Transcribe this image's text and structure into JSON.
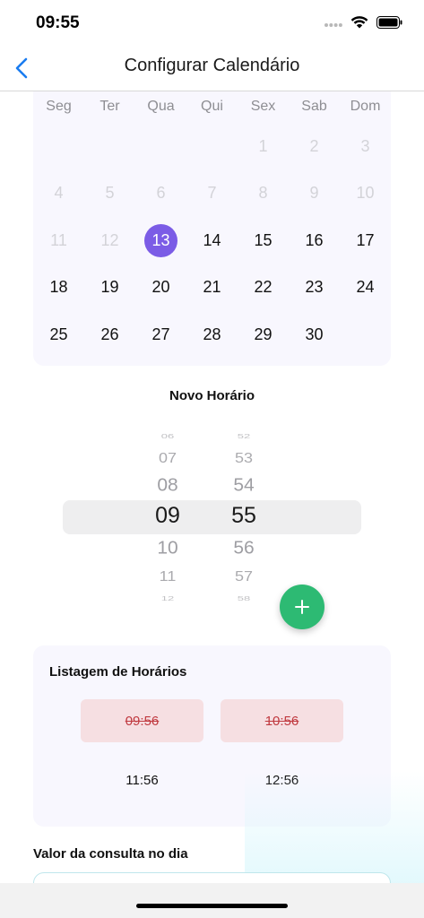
{
  "status_bar": {
    "time": "09:55"
  },
  "nav": {
    "title": "Configurar Calendário"
  },
  "calendar": {
    "weekdays": [
      "Seg",
      "Ter",
      "Qua",
      "Qui",
      "Sex",
      "Sab",
      "Dom"
    ],
    "rows": [
      [
        "",
        "",
        "",
        "",
        "1",
        "2",
        "3"
      ],
      [
        "4",
        "5",
        "6",
        "7",
        "8",
        "9",
        "10"
      ],
      [
        "11",
        "12",
        "13",
        "14",
        "15",
        "16",
        "17"
      ],
      [
        "18",
        "19",
        "20",
        "21",
        "22",
        "23",
        "24"
      ],
      [
        "25",
        "26",
        "27",
        "28",
        "29",
        "30",
        ""
      ]
    ],
    "muted_days": [
      "1",
      "2",
      "3",
      "4",
      "5",
      "6",
      "7",
      "8",
      "9",
      "10",
      "11",
      "12"
    ],
    "selected_day": "13",
    "accent_color": "#7b5ce6"
  },
  "new_time": {
    "title": "Novo Horário",
    "hours": [
      "06",
      "07",
      "08",
      "09",
      "10",
      "11",
      "12"
    ],
    "minutes": [
      "52",
      "53",
      "54",
      "55",
      "56",
      "57",
      "58"
    ],
    "selected_hour": "09",
    "selected_minute": "55",
    "add_icon": "plus-icon",
    "add_color": "#2dba73"
  },
  "schedule_list": {
    "title": "Listagem de Horários",
    "slots": [
      {
        "time": "09:56",
        "state": "removed"
      },
      {
        "time": "10:56",
        "state": "removed"
      },
      {
        "time": "11:56",
        "state": "active"
      },
      {
        "time": "12:56",
        "state": "active"
      }
    ]
  },
  "price": {
    "label": "Valor da consulta no dia"
  }
}
